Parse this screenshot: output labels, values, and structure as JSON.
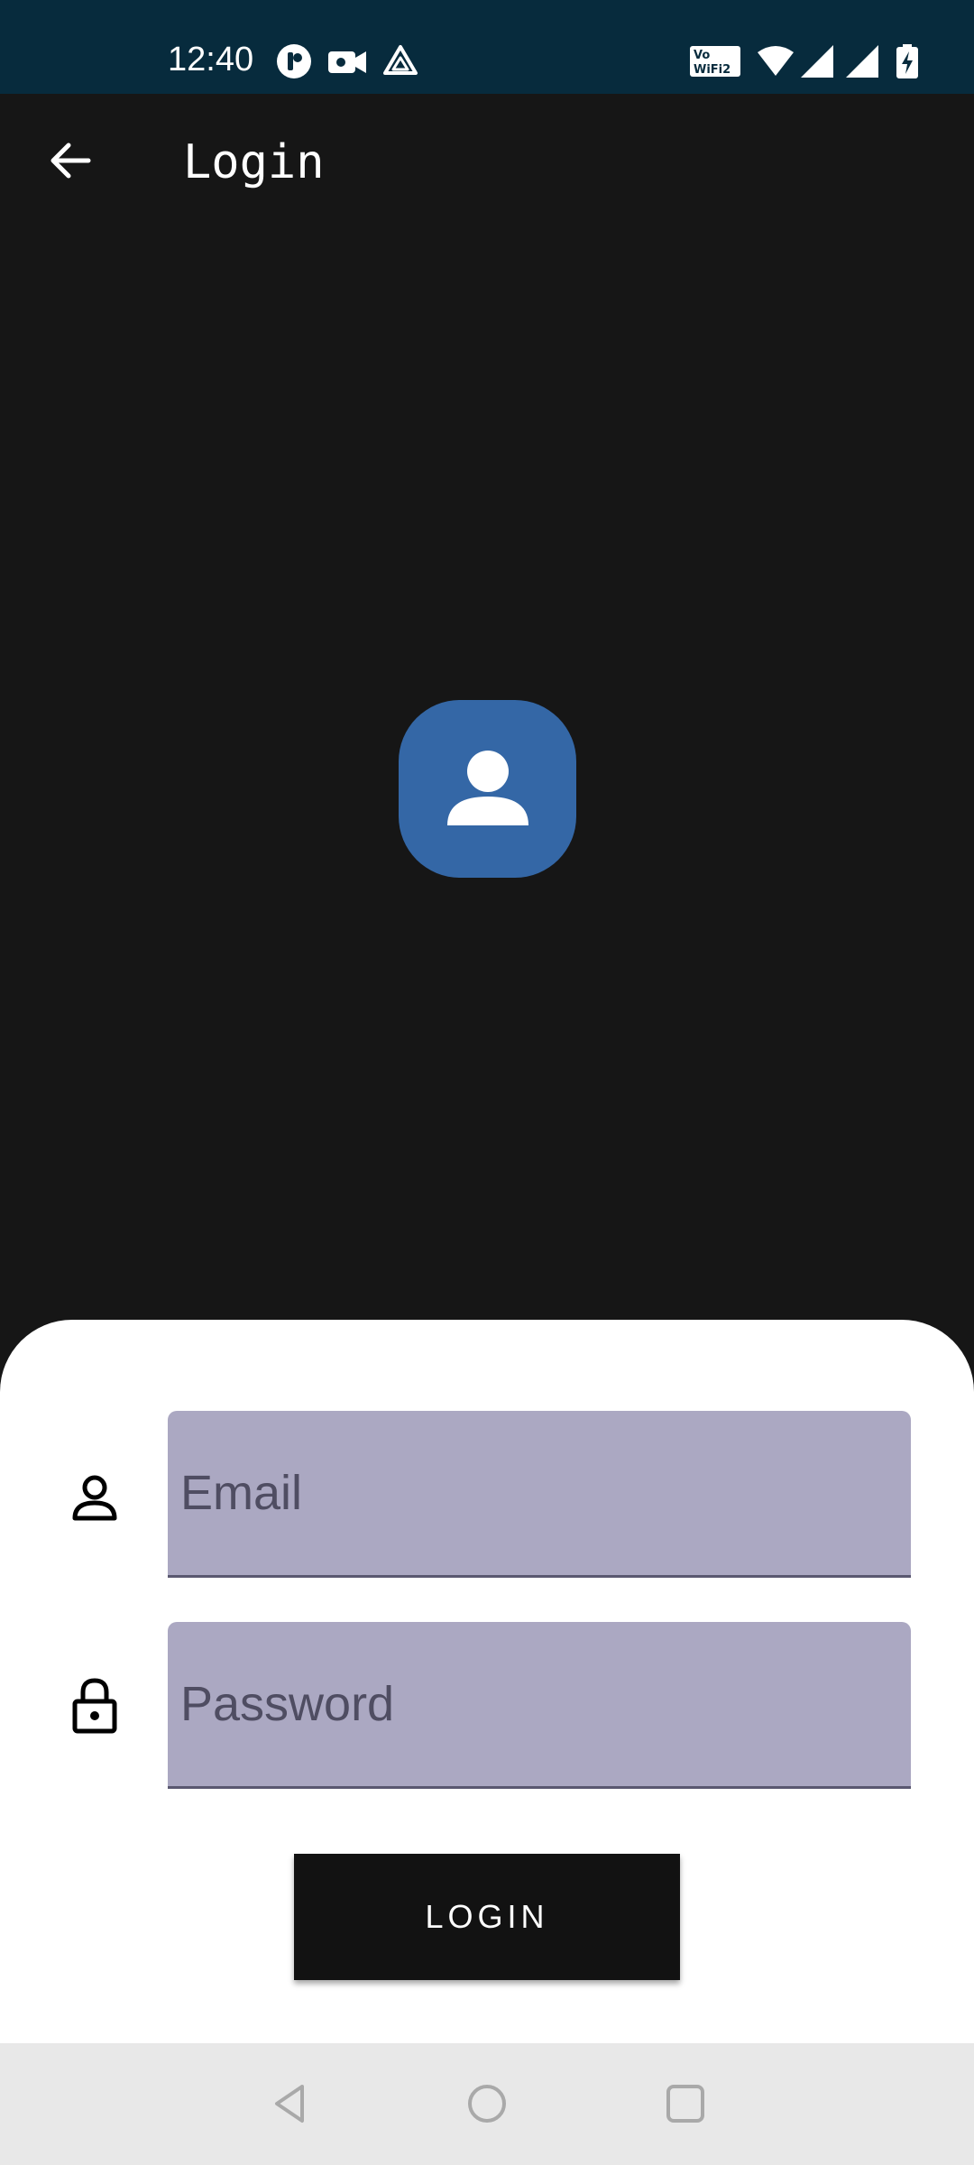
{
  "status_bar": {
    "time": "12:40",
    "left_icons": [
      "app-c-icon",
      "video-camera-icon",
      "drive-icon"
    ],
    "right_icons": [
      "vowifi-icon",
      "wifi-icon",
      "signal-icon",
      "signal-icon",
      "battery-charging-icon"
    ]
  },
  "app_bar": {
    "title": "Login",
    "back_icon": "arrow-left-icon"
  },
  "avatar": {
    "icon": "person-icon",
    "color": "#3467a6"
  },
  "form": {
    "email": {
      "placeholder": "Email",
      "value": "",
      "icon": "person-outline-icon"
    },
    "password": {
      "placeholder": "Password",
      "value": "",
      "icon": "lock-icon"
    },
    "login_label": "LOGIN"
  },
  "nav_bar": {
    "items": [
      "back-icon",
      "home-icon",
      "recents-icon"
    ]
  },
  "colors": {
    "status_bar": "#072b3d",
    "background": "#161616",
    "field_fill": "#aba8c2",
    "button": "#121212"
  }
}
